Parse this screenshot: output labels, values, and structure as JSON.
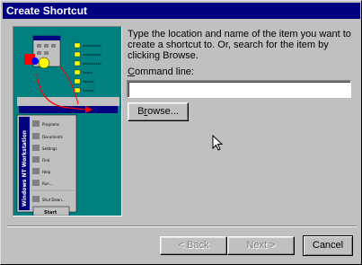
{
  "window": {
    "title": "Create Shortcut"
  },
  "instructions": "Type the location and name of the item you want to create a shortcut to. Or, search for the item by clicking Browse.",
  "command_line": {
    "label_prefix": "",
    "label_accel": "C",
    "label_rest": "ommand line:",
    "value": ""
  },
  "buttons": {
    "browse_accel": "r",
    "browse_pre": "B",
    "browse_post": "owse...",
    "back_label": "< Back",
    "next_label": "Next >",
    "cancel_label": "Cancel"
  },
  "illustration": {
    "start_menu": {
      "side_text": "Windows NT Workstation",
      "items": [
        "Programs",
        "Documents",
        "Settings",
        "Find",
        "Help",
        "Run...",
        "Shut Down..."
      ],
      "start_label": "Start"
    },
    "folder_items": [
      "xxxxxxxxxx",
      "xxxxxxxxxx",
      "xxxxxxxxxx",
      "Xxxxx",
      "Xxxxxx",
      "Xxxxxx"
    ]
  },
  "colors": {
    "title_bg": "#000080",
    "illustration_bg": "#008080",
    "face": "#c0c0c0"
  }
}
